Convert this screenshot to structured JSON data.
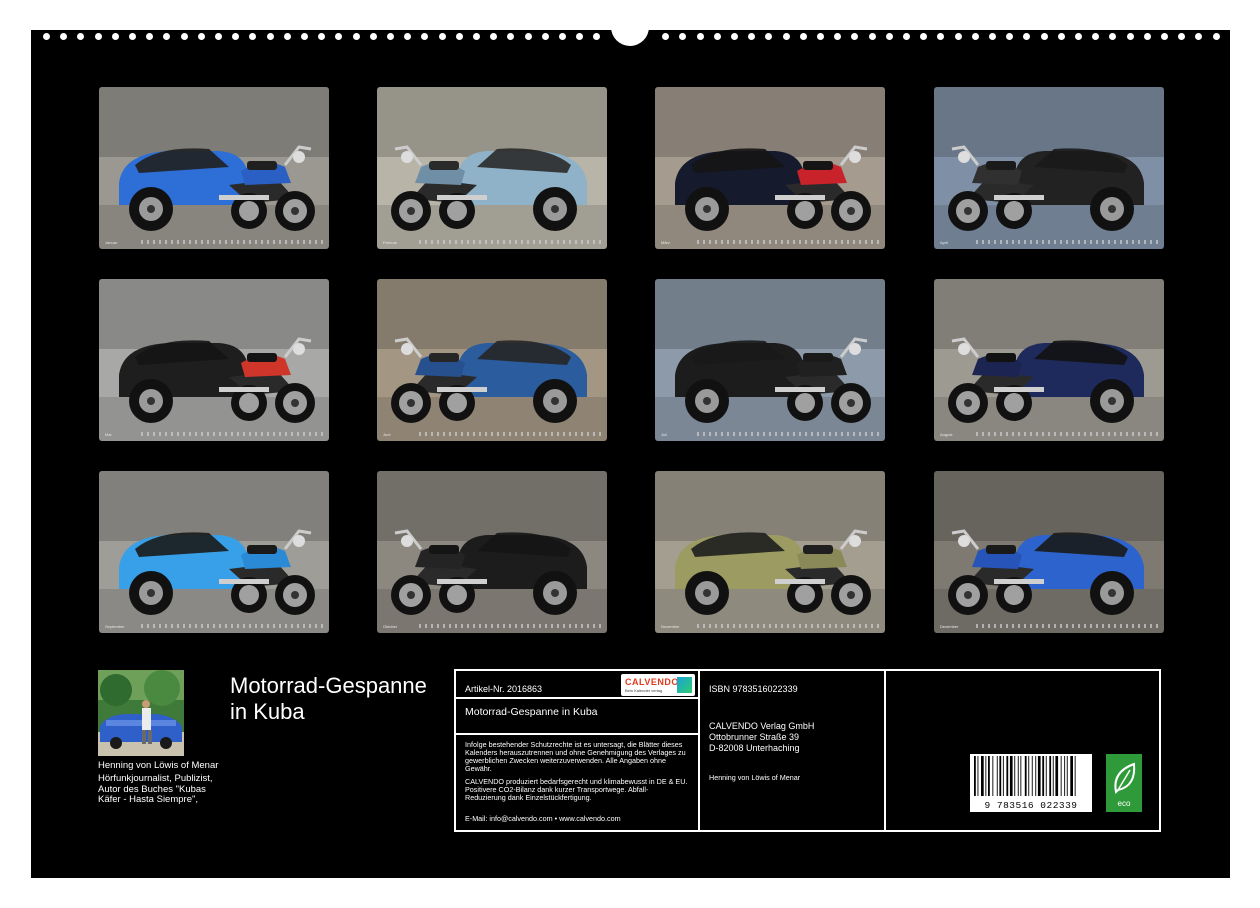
{
  "calendar": {
    "months": [
      {
        "caption": "Januar",
        "photo": "blue-sidecar-motorcycle",
        "bg": "#9a9890",
        "bike": "#2a5fc4",
        "car": "#2d6fd6",
        "seat": "#202020"
      },
      {
        "caption": "Februar",
        "photo": "riders-on-lightblue-sidecar",
        "bg": "#b8b4a8",
        "bike": "#6f8fa6",
        "car": "#8fb2c8",
        "seat": "#2a2a2a"
      },
      {
        "caption": "März",
        "photo": "red-motorcycle-black-sidecar",
        "bg": "#a59b8f",
        "bike": "#c8222b",
        "car": "#151a2c",
        "seat": "#151515"
      },
      {
        "caption": "April",
        "photo": "rider-passing-blue-bus",
        "bg": "#7f90a6",
        "bike": "#303030",
        "car": "#222222",
        "seat": "#1a1a1a"
      },
      {
        "caption": "Mai",
        "photo": "red-motorcycle-black-sidecar",
        "bg": "#a8a8a6",
        "bike": "#d0352a",
        "car": "#1e1e1e",
        "seat": "#141414"
      },
      {
        "caption": "Juni",
        "photo": "blue-sidecar-by-wall",
        "bg": "#a39784",
        "bike": "#27508e",
        "car": "#2a5c9e",
        "seat": "#262626"
      },
      {
        "caption": "Juli",
        "photo": "riders-with-red-helmets",
        "bg": "#8d9aaa",
        "bike": "#202020",
        "car": "#1c1c1c",
        "seat": "#1a1a1a"
      },
      {
        "caption": "August",
        "photo": "navy-sidecar-motorcycle",
        "bg": "#9d9a92",
        "bike": "#1c2452",
        "car": "#1f2a5c",
        "seat": "#121212"
      },
      {
        "caption": "September",
        "photo": "bright-blue-sidecar",
        "bg": "#9e9d98",
        "bike": "#2a8ad6",
        "car": "#38a0e8",
        "seat": "#1a1a1a"
      },
      {
        "caption": "Oktober",
        "photo": "rider-black-sidecar",
        "bg": "#8c8880",
        "bike": "#242424",
        "car": "#1c1c1c",
        "seat": "#151515"
      },
      {
        "caption": "November",
        "photo": "olive-green-sidecar",
        "bg": "#a39e90",
        "bike": "#8a8a58",
        "car": "#9c9c62",
        "seat": "#1f1f1f"
      },
      {
        "caption": "Dezember",
        "photo": "blue-sidecar-spare-wheel",
        "bg": "#7e7a72",
        "bike": "#2654b8",
        "car": "#2c63cc",
        "seat": "#1a1a1a"
      }
    ]
  },
  "author": {
    "name": "Henning von Löwis of Menar",
    "bio": "Hörfunkjournalist, Publizist, Autor des Buches \"Kubas Käfer - Hasta Siempre\",",
    "photo": "author-with-blue-car"
  },
  "title": {
    "line1": "Motorrad-Gespanne",
    "line2": "in Kuba"
  },
  "info": {
    "article_no": "Artikel-Nr. 2016863",
    "logo_text": "CALVENDO",
    "logo_sub": "Bein Kalender verlag",
    "product_title": "Motorrad-Gespanne in Kuba",
    "legal": "Infolge bestehender Schutzrechte ist es untersagt, die Blätter dieses Kalenders herauszutrennen und ohne Genehmigung des Verlages zu gewerblichen Zwecken weiterzuverwenden. Alle Angaben ohne Gewähr.",
    "eco_note": "CALVENDO produziert bedarfsgerecht und klimabewusst in DE & EU. Positivere CO2-Bilanz dank kurzer Transportwege. Abfall-Reduzierung dank Einzelstückfertigung.",
    "contact": "E-Mail: info@calvendo.com • www.calvendo.com",
    "isbn": "ISBN 9783516022339",
    "publisher_name": "CALVENDO Verlag GmbH",
    "publisher_street": "Ottobrunner Straße 39",
    "publisher_city": "D-82008 Unterhaching",
    "author_credit": "Henning von Löwis of Menar",
    "barcode_digits": "9 783516 022339",
    "eco_label": "eco"
  }
}
